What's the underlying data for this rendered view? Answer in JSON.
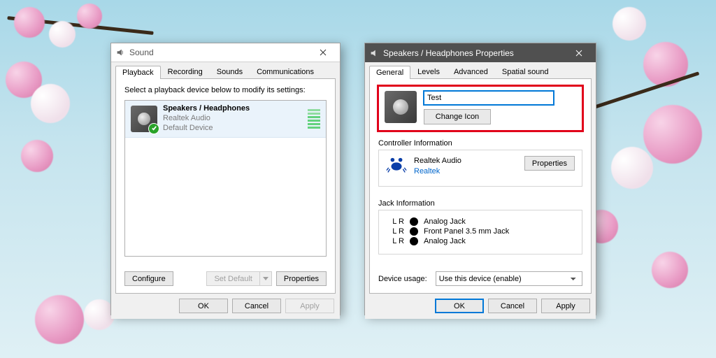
{
  "sound_window": {
    "title": "Sound",
    "tabs": [
      "Playback",
      "Recording",
      "Sounds",
      "Communications"
    ],
    "active_tab": 0,
    "instruction": "Select a playback device below to modify its settings:",
    "device": {
      "name": "Speakers / Headphones",
      "driver": "Realtek Audio",
      "status": "Default Device"
    },
    "buttons": {
      "configure": "Configure",
      "set_default": "Set Default",
      "properties": "Properties"
    },
    "footer": {
      "ok": "OK",
      "cancel": "Cancel",
      "apply": "Apply"
    }
  },
  "props_window": {
    "title": "Speakers / Headphones Properties",
    "tabs": [
      "General",
      "Levels",
      "Advanced",
      "Spatial sound"
    ],
    "active_tab": 0,
    "name_value": "Test",
    "change_icon": "Change Icon",
    "controller_section_label": "Controller Information",
    "controller": {
      "name": "Realtek Audio",
      "vendor": "Realtek",
      "properties_btn": "Properties"
    },
    "jack_section_label": "Jack Information",
    "jacks": [
      {
        "lr": "L R",
        "label": "Analog Jack"
      },
      {
        "lr": "L R",
        "label": "Front Panel 3.5 mm Jack"
      },
      {
        "lr": "L R",
        "label": "Analog Jack"
      }
    ],
    "usage_label": "Device usage:",
    "usage_value": "Use this device (enable)",
    "footer": {
      "ok": "OK",
      "cancel": "Cancel",
      "apply": "Apply"
    }
  }
}
